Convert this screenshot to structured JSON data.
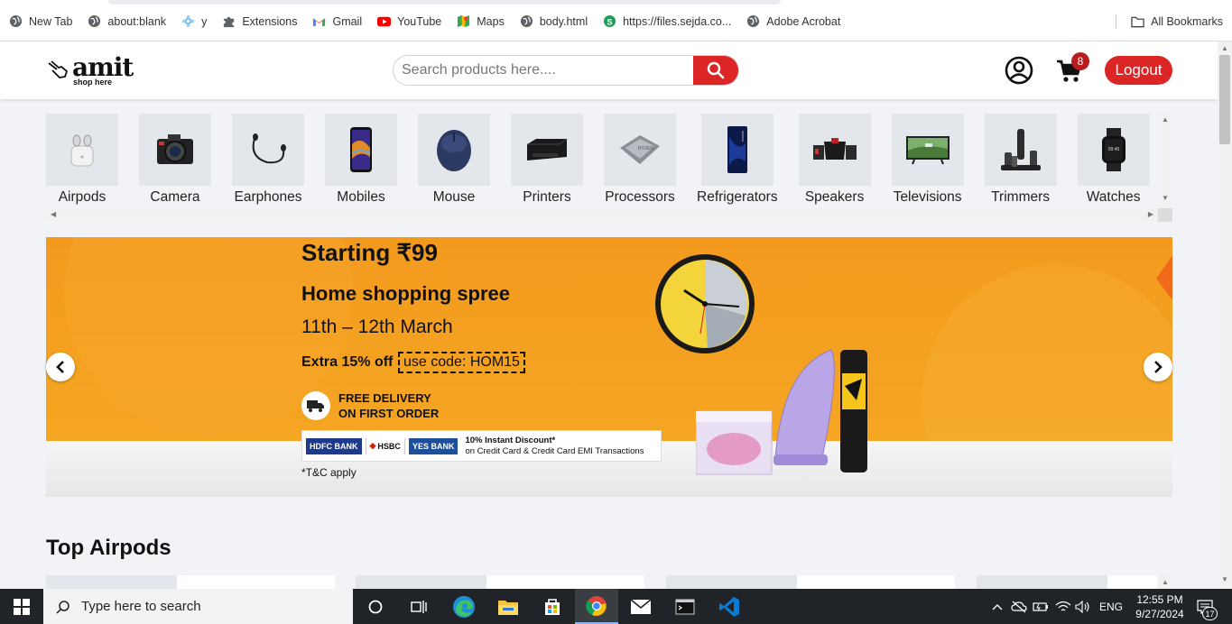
{
  "bookmarks": [
    {
      "label": "New Tab",
      "icon": "globe-icon"
    },
    {
      "label": "about:blank",
      "icon": "globe-icon"
    },
    {
      "label": "y",
      "icon": "y-flower-icon"
    },
    {
      "label": "Extensions",
      "icon": "puzzle-icon"
    },
    {
      "label": "Gmail",
      "icon": "gmail-icon"
    },
    {
      "label": "YouTube",
      "icon": "youtube-icon"
    },
    {
      "label": "Maps",
      "icon": "maps-icon"
    },
    {
      "label": "body.html",
      "icon": "globe-icon"
    },
    {
      "label": "https://files.sejda.co...",
      "icon": "sejda-icon"
    },
    {
      "label": "Adobe Acrobat",
      "icon": "globe-icon"
    }
  ],
  "all_bookmarks": "All Bookmarks",
  "header": {
    "logo_word": "amit",
    "logo_tagline": "shop here",
    "search_placeholder": "Search products here....",
    "cart_count": "8",
    "logout_label": "Logout",
    "accent_color": "#dc2626"
  },
  "categories": [
    {
      "label": "Airpods",
      "icon": "airpods-icon"
    },
    {
      "label": "Camera",
      "icon": "camera-icon"
    },
    {
      "label": "Earphones",
      "icon": "earphones-icon"
    },
    {
      "label": "Mobiles",
      "icon": "mobile-icon"
    },
    {
      "label": "Mouse",
      "icon": "mouse-icon"
    },
    {
      "label": "Printers",
      "icon": "printer-icon"
    },
    {
      "label": "Processors",
      "icon": "processor-icon"
    },
    {
      "label": "Refrigerators",
      "icon": "refrigerator-icon"
    },
    {
      "label": "Speakers",
      "icon": "speaker-icon"
    },
    {
      "label": "Televisions",
      "icon": "television-icon"
    },
    {
      "label": "Trimmers",
      "icon": "trimmer-icon"
    },
    {
      "label": "Watches",
      "icon": "watch-icon"
    }
  ],
  "banner": {
    "title": "Starting ₹99",
    "subtitle": "Home shopping spree",
    "date_text": "11th – 12th March",
    "offer_text": "Extra 15% off",
    "code_text": "use code: HOM15",
    "free_delivery_line1": "FREE DELIVERY",
    "free_delivery_line2": "ON FIRST ORDER",
    "banks": [
      "HDFC BANK",
      "HSBC",
      "YES BANK"
    ],
    "bank_discount_line1": "10% Instant Discount*",
    "bank_discount_line2": "on Credit Card & Credit Card EMI Transactions",
    "tc_text": "*T&C apply"
  },
  "section": {
    "heading": "Top Airpods"
  },
  "taskbar": {
    "search_placeholder": "Type here to search",
    "language": "ENG",
    "time": "12:55 PM",
    "date": "9/27/2024",
    "notification_count": "17"
  }
}
